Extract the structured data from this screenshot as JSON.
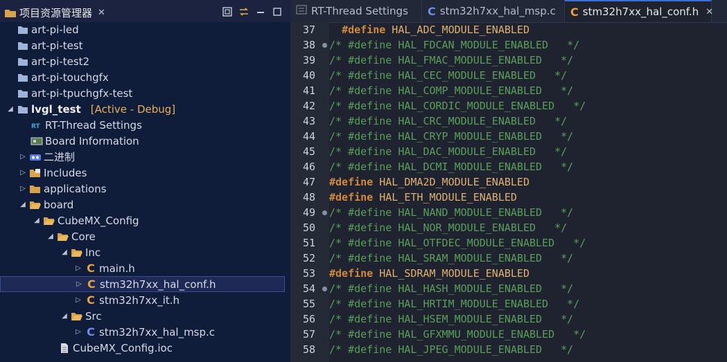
{
  "colors": {
    "sidebar_bg": "#0f1c3a",
    "editor_bg": "#1f2330",
    "comment": "#5a9e5a",
    "define": "#d08a3a",
    "macro": "#e0b070",
    "selection": "#1e2a55",
    "c_header_icon": "#e8a13a",
    "c_source_icon": "#6b8ee8"
  },
  "explorer": {
    "title": "项目资源管理器",
    "tools": [
      "collapse-all-icon",
      "link-editor-icon",
      "minimize-icon",
      "maximize-icon"
    ],
    "items": [
      {
        "label": "art-pi-led",
        "icon": "project-folder-icon"
      },
      {
        "label": "art-pi-test",
        "icon": "project-folder-icon"
      },
      {
        "label": "art-pi-test2",
        "icon": "project-folder-icon"
      },
      {
        "label": "art-pi-touchgfx",
        "icon": "project-folder-icon"
      },
      {
        "label": "art-pi-tpuchgfx-test",
        "icon": "project-folder-icon"
      },
      {
        "label": "lvgl_test",
        "badge": "[Active - Debug]",
        "icon": "project-folder-icon"
      },
      {
        "label": "RT-Thread Settings",
        "icon": "rt-thread-icon"
      },
      {
        "label": "Board Information",
        "icon": "board-icon"
      },
      {
        "label": "二进制",
        "icon": "binary-icon"
      },
      {
        "label": "Includes",
        "icon": "includes-icon"
      },
      {
        "label": "applications",
        "icon": "folder-icon"
      },
      {
        "label": "board",
        "icon": "folder-open-icon"
      },
      {
        "label": "CubeMX_Config",
        "icon": "folder-open-icon"
      },
      {
        "label": "Core",
        "icon": "folder-open-icon"
      },
      {
        "label": "Inc",
        "icon": "folder-open-icon"
      },
      {
        "label": "main.h",
        "icon": "c-header-icon"
      },
      {
        "label": "stm32h7xx_hal_conf.h",
        "icon": "c-header-icon"
      },
      {
        "label": "stm32h7xx_it.h",
        "icon": "c-header-icon"
      },
      {
        "label": "Src",
        "icon": "folder-open-icon"
      },
      {
        "label": "stm32h7xx_hal_msp.c",
        "icon": "c-source-icon"
      },
      {
        "label": "CubeMX_Config.ioc",
        "icon": "file-icon"
      }
    ]
  },
  "tabs": [
    {
      "label": "RT-Thread Settings",
      "icon": "rt-thread-icon"
    },
    {
      "label": "stm32h7xx_hal_msp.c",
      "icon": "c-source-icon"
    },
    {
      "label": "stm32h7xx_hal_conf.h",
      "icon": "c-header-icon"
    }
  ],
  "code": {
    "lines": [
      {
        "n": "37",
        "parts": [
          {
            "c": "ws",
            "t": "  "
          },
          {
            "c": "kw",
            "t": "#define"
          },
          {
            "c": "mac",
            "t": " HAL_ADC_MODULE_ENABLED"
          }
        ]
      },
      {
        "n": "38",
        "parts": [
          {
            "c": "cmt",
            "t": "/* #define HAL_FDCAN_MODULE_ENABLED   */"
          }
        ]
      },
      {
        "n": "39",
        "parts": [
          {
            "c": "cmt",
            "t": "/* #define HAL_FMAC_MODULE_ENABLED   */"
          }
        ]
      },
      {
        "n": "40",
        "parts": [
          {
            "c": "cmt",
            "t": "/* #define HAL_CEC_MODULE_ENABLED   */"
          }
        ]
      },
      {
        "n": "41",
        "parts": [
          {
            "c": "cmt",
            "t": "/* #define HAL_COMP_MODULE_ENABLED   */"
          }
        ]
      },
      {
        "n": "42",
        "parts": [
          {
            "c": "cmt",
            "t": "/* #define HAL_CORDIC_MODULE_ENABLED   */"
          }
        ]
      },
      {
        "n": "43",
        "parts": [
          {
            "c": "cmt",
            "t": "/* #define HAL_CRC_MODULE_ENABLED   */"
          }
        ]
      },
      {
        "n": "44",
        "parts": [
          {
            "c": "cmt",
            "t": "/* #define HAL_CRYP_MODULE_ENABLED   */"
          }
        ]
      },
      {
        "n": "45",
        "parts": [
          {
            "c": "cmt",
            "t": "/* #define HAL_DAC_MODULE_ENABLED   */"
          }
        ]
      },
      {
        "n": "46",
        "parts": [
          {
            "c": "cmt",
            "t": "/* #define HAL_DCMI_MODULE_ENABLED   */"
          }
        ]
      },
      {
        "n": "47",
        "parts": [
          {
            "c": "kw",
            "t": "#define"
          },
          {
            "c": "mac",
            "t": " HAL_DMA2D_MODULE_ENABLED"
          }
        ]
      },
      {
        "n": "48",
        "parts": [
          {
            "c": "kw",
            "t": "#define"
          },
          {
            "c": "mac",
            "t": " HAL_ETH_MODULE_ENABLED"
          }
        ]
      },
      {
        "n": "49",
        "parts": [
          {
            "c": "cmt",
            "t": "/* #define HAL_NAND_MODULE_ENABLED   */"
          }
        ]
      },
      {
        "n": "50",
        "parts": [
          {
            "c": "cmt",
            "t": "/* #define HAL_NOR_MODULE_ENABLED   */"
          }
        ]
      },
      {
        "n": "51",
        "parts": [
          {
            "c": "cmt",
            "t": "/* #define HAL_OTFDEC_MODULE_ENABLED   */"
          }
        ]
      },
      {
        "n": "52",
        "parts": [
          {
            "c": "cmt",
            "t": "/* #define HAL_SRAM_MODULE_ENABLED   */"
          }
        ]
      },
      {
        "n": "53",
        "parts": [
          {
            "c": "kw",
            "t": "#define"
          },
          {
            "c": "mac",
            "t": " HAL_SDRAM_MODULE_ENABLED"
          }
        ]
      },
      {
        "n": "54",
        "parts": [
          {
            "c": "cmt",
            "t": "/* #define HAL_HASH_MODULE_ENABLED   */"
          }
        ]
      },
      {
        "n": "55",
        "parts": [
          {
            "c": "cmt",
            "t": "/* #define HAL_HRTIM_MODULE_ENABLED   */"
          }
        ]
      },
      {
        "n": "56",
        "parts": [
          {
            "c": "cmt",
            "t": "/* #define HAL_HSEM_MODULE_ENABLED   */"
          }
        ]
      },
      {
        "n": "57",
        "parts": [
          {
            "c": "cmt",
            "t": "/* #define HAL_GFXMMU_MODULE_ENABLED   */"
          }
        ]
      },
      {
        "n": "58",
        "parts": [
          {
            "c": "cmt",
            "t": "/* #define HAL_JPEG_MODULE_ENABLED   */"
          }
        ]
      }
    ]
  }
}
